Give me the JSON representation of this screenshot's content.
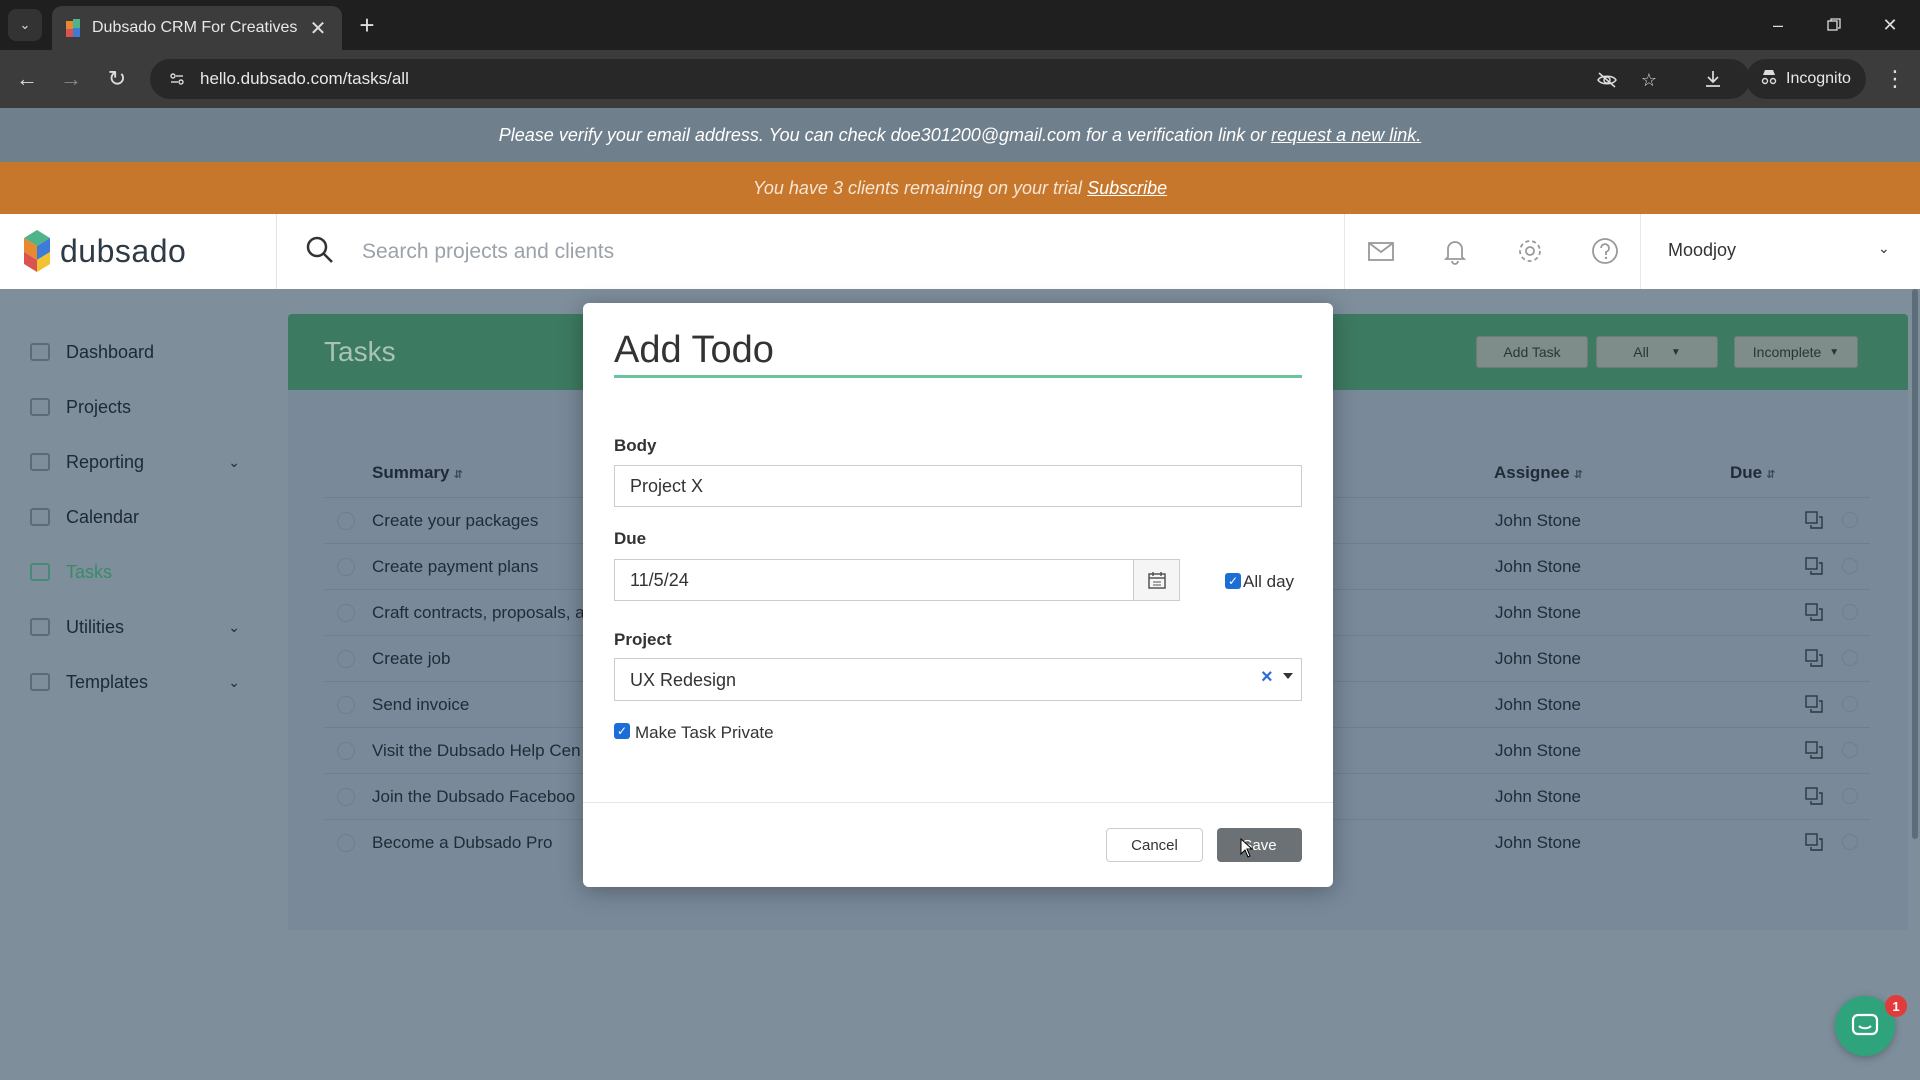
{
  "browser": {
    "tab_title": "Dubsado CRM For Creatives",
    "url": "hello.dubsado.com/tasks/all",
    "incognito_label": "Incognito",
    "icons": [
      "tab-list-icon",
      "close-icon",
      "plus-icon",
      "minimize-icon",
      "restore-icon",
      "back-icon",
      "forward-icon",
      "reload-icon",
      "site-info-icon",
      "eye-off-icon",
      "star-icon",
      "download-icon",
      "incognito-icon",
      "more-vertical-icon"
    ]
  },
  "banners": {
    "verify_text": "Please verify your email address. You can check doe301200@gmail.com for a verification link or",
    "verify_link": "request a new link.",
    "trial_text": "You have 3 clients remaining on your trial",
    "trial_link": "Subscribe"
  },
  "header": {
    "logo_text": "dubsado",
    "search_placeholder": "Search projects and clients",
    "account_name": "Moodjoy",
    "icons": [
      "mail-icon",
      "bell-icon",
      "gear-icon",
      "help-icon"
    ]
  },
  "sidebar": {
    "items": [
      {
        "label": "Dashboard",
        "has_children": false
      },
      {
        "label": "Projects",
        "has_children": false
      },
      {
        "label": "Reporting",
        "has_children": true
      },
      {
        "label": "Calendar",
        "has_children": false
      },
      {
        "label": "Tasks",
        "has_children": false,
        "active": true
      },
      {
        "label": "Utilities",
        "has_children": true
      },
      {
        "label": "Templates",
        "has_children": true
      }
    ]
  },
  "tasks": {
    "title": "Tasks",
    "add_task_label": "Add Task",
    "filter_all_label": "All",
    "filter_status_label": "Incomplete",
    "columns": {
      "summary": "Summary",
      "assignee": "Assignee",
      "due": "Due"
    },
    "rows": [
      {
        "summary": "Create your packages",
        "assignee": "John Stone"
      },
      {
        "summary": "Create payment plans",
        "assignee": "John Stone"
      },
      {
        "summary": "Craft contracts, proposals, a",
        "assignee": "John Stone"
      },
      {
        "summary": "Create job",
        "assignee": "John Stone"
      },
      {
        "summary": "Send invoice",
        "assignee": "John Stone"
      },
      {
        "summary": "Visit the Dubsado Help Cen",
        "assignee": "John Stone"
      },
      {
        "summary": "Join the Dubsado Faceboo",
        "assignee": "John Stone"
      },
      {
        "summary": "Become a Dubsado Pro",
        "assignee": "John Stone"
      }
    ]
  },
  "modal": {
    "title": "Add Todo",
    "body_label": "Body",
    "body_value": "Project X",
    "due_label": "Due",
    "due_value": "11/5/24",
    "all_day_label": "All day",
    "all_day_checked": true,
    "project_label": "Project",
    "project_value": "UX Redesign",
    "private_label": "Make Task Private",
    "private_checked": true,
    "cancel_label": "Cancel",
    "save_label": "Save"
  },
  "chat": {
    "badge_count": "1"
  },
  "colors": {
    "accent_green": "#6cc3a0",
    "trial_orange": "#e8892f",
    "checkbox_blue": "#1b6ed6"
  }
}
